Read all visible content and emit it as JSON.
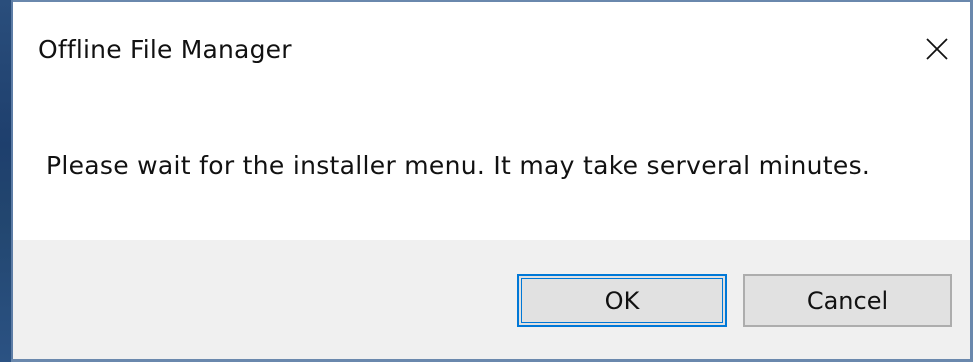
{
  "window": {
    "title": "Offline File Manager",
    "close_icon": "close-icon"
  },
  "content": {
    "message": "Please wait for the installer menu. It may take serveral minutes."
  },
  "buttons": {
    "ok_label": "OK",
    "cancel_label": "Cancel"
  },
  "colors": {
    "accent": "#0078d7",
    "footer_bg": "#f0f0f0",
    "button_bg": "#e1e1e1"
  }
}
